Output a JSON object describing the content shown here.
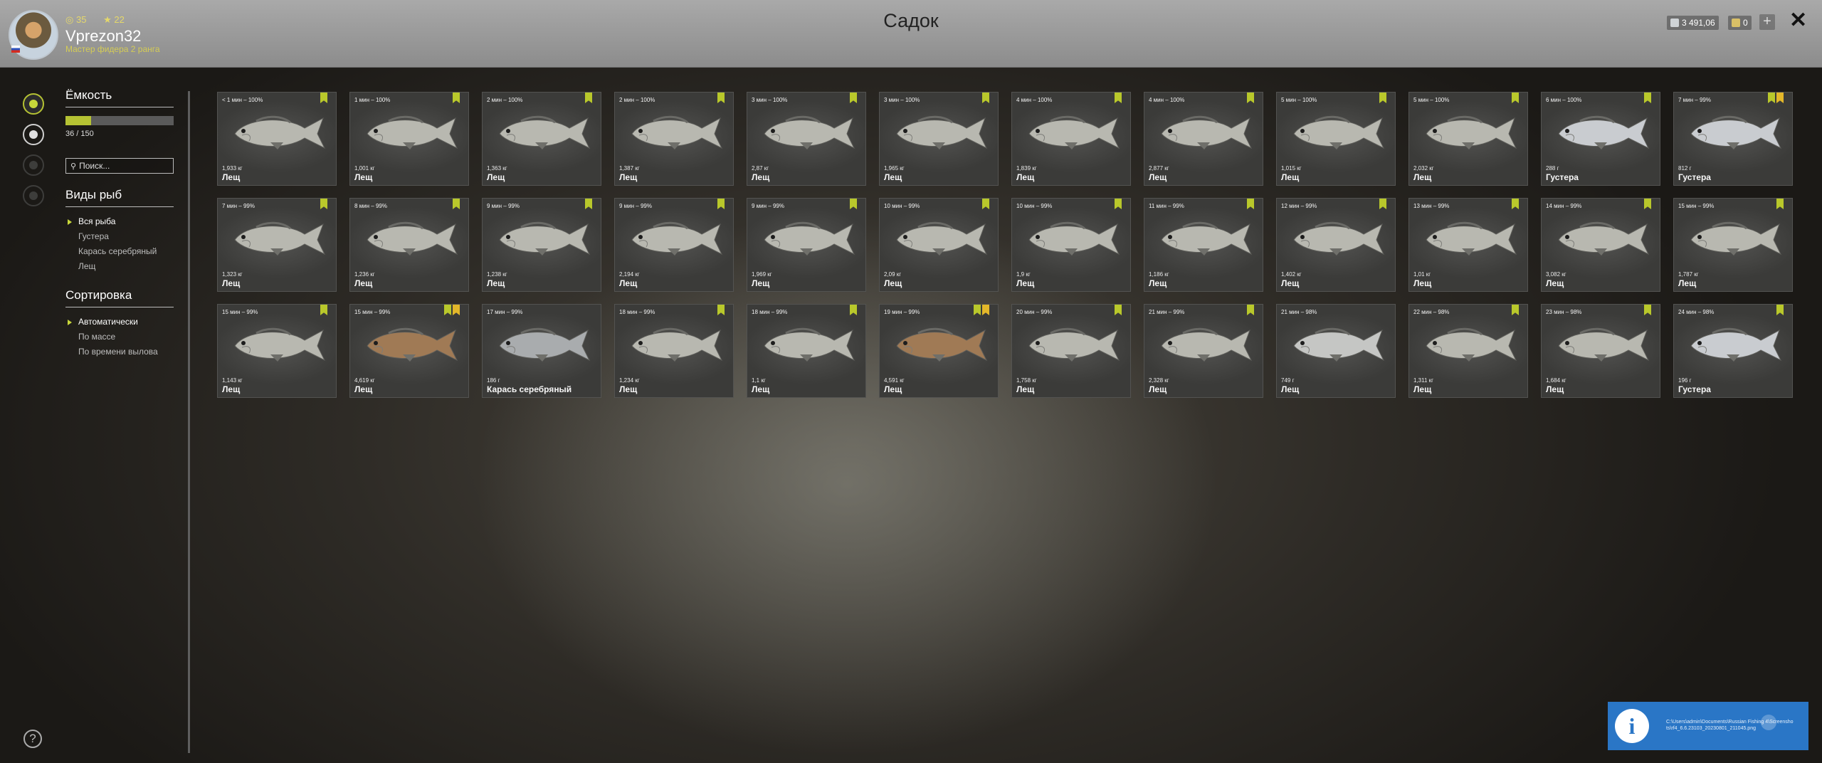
{
  "header": {
    "title": "Садок",
    "stat1": "35",
    "stat2": "22",
    "username": "Vprezon32",
    "rank": "Мастер фидера 2 ранга",
    "silver": "3 491,06",
    "gold": "0",
    "plus": "+",
    "close": "✕"
  },
  "sidebar": {
    "capacity_title": "Ёмкость",
    "capacity_fill": 0.24,
    "capacity_text": "36 / 150",
    "search_placeholder": "Поиск...",
    "species_title": "Виды рыб",
    "species": [
      "Вся рыба",
      "Густера",
      "Карась серебряный",
      "Лещ"
    ],
    "sort_title": "Сортировка",
    "sort": [
      "Автоматически",
      "По массе",
      "По времени вылова"
    ]
  },
  "help": "?",
  "fish": [
    {
      "time": "< 1 мин – 100%",
      "weight": "1,933 кг",
      "name": "Лещ",
      "badges": [
        "green"
      ],
      "color": "#b8b8b0"
    },
    {
      "time": "1 мин – 100%",
      "weight": "1,001 кг",
      "name": "Лещ",
      "badges": [
        "green"
      ],
      "color": "#b8b8b0"
    },
    {
      "time": "2 мин – 100%",
      "weight": "1,363 кг",
      "name": "Лещ",
      "badges": [
        "green"
      ],
      "color": "#b8b8b0"
    },
    {
      "time": "2 мин – 100%",
      "weight": "1,387 кг",
      "name": "Лещ",
      "badges": [
        "green"
      ],
      "color": "#b8b8b0"
    },
    {
      "time": "3 мин – 100%",
      "weight": "2,87 кг",
      "name": "Лещ",
      "badges": [
        "green"
      ],
      "color": "#b8b8b0"
    },
    {
      "time": "3 мин – 100%",
      "weight": "1,965 кг",
      "name": "Лещ",
      "badges": [
        "green"
      ],
      "color": "#b8b8b0"
    },
    {
      "time": "4 мин – 100%",
      "weight": "1,839 кг",
      "name": "Лещ",
      "badges": [
        "green"
      ],
      "color": "#b8b8b0"
    },
    {
      "time": "4 мин – 100%",
      "weight": "2,877 кг",
      "name": "Лещ",
      "badges": [
        "green"
      ],
      "color": "#b8b8b0"
    },
    {
      "time": "5 мин – 100%",
      "weight": "1,015 кг",
      "name": "Лещ",
      "badges": [
        "green"
      ],
      "color": "#b8b8b0"
    },
    {
      "time": "5 мин – 100%",
      "weight": "2,032 кг",
      "name": "Лещ",
      "badges": [
        "green"
      ],
      "color": "#b8b8b0"
    },
    {
      "time": "6 мин – 100%",
      "weight": "288 г",
      "name": "Густера",
      "badges": [
        "green"
      ],
      "color": "#c9ccd0"
    },
    {
      "time": "7 мин – 99%",
      "weight": "812 г",
      "name": "Густера",
      "badges": [
        "green",
        "gold"
      ],
      "color": "#c9ccd0"
    },
    {
      "time": "7 мин – 99%",
      "weight": "1,323 кг",
      "name": "Лещ",
      "badges": [
        "green"
      ],
      "color": "#b8b8b0"
    },
    {
      "time": "8 мин – 99%",
      "weight": "1,236 кг",
      "name": "Лещ",
      "badges": [
        "green"
      ],
      "color": "#b8b8b0"
    },
    {
      "time": "9 мин – 99%",
      "weight": "1,238 кг",
      "name": "Лещ",
      "badges": [
        "green"
      ],
      "color": "#b8b8b0"
    },
    {
      "time": "9 мин – 99%",
      "weight": "2,194 кг",
      "name": "Лещ",
      "badges": [
        "green"
      ],
      "color": "#b8b8b0"
    },
    {
      "time": "9 мин – 99%",
      "weight": "1,969 кг",
      "name": "Лещ",
      "badges": [
        "green"
      ],
      "color": "#b8b8b0"
    },
    {
      "time": "10 мин – 99%",
      "weight": "2,09 кг",
      "name": "Лещ",
      "badges": [
        "green"
      ],
      "color": "#b8b8b0"
    },
    {
      "time": "10 мин – 99%",
      "weight": "1,9 кг",
      "name": "Лещ",
      "badges": [
        "green"
      ],
      "color": "#b8b8b0"
    },
    {
      "time": "11 мин – 99%",
      "weight": "1,186 кг",
      "name": "Лещ",
      "badges": [
        "green"
      ],
      "color": "#b8b8b0"
    },
    {
      "time": "12 мин – 99%",
      "weight": "1,402 кг",
      "name": "Лещ",
      "badges": [
        "green"
      ],
      "color": "#b8b8b0"
    },
    {
      "time": "13 мин – 99%",
      "weight": "1,01 кг",
      "name": "Лещ",
      "badges": [
        "green"
      ],
      "color": "#b8b8b0"
    },
    {
      "time": "14 мин – 99%",
      "weight": "3,082 кг",
      "name": "Лещ",
      "badges": [
        "green"
      ],
      "color": "#b8b8b0"
    },
    {
      "time": "15 мин – 99%",
      "weight": "1,787 кг",
      "name": "Лещ",
      "badges": [
        "green"
      ],
      "color": "#b8b8b0"
    },
    {
      "time": "15 мин – 99%",
      "weight": "1,143 кг",
      "name": "Лещ",
      "badges": [
        "green"
      ],
      "color": "#b8b8b0"
    },
    {
      "time": "15 мин – 99%",
      "weight": "4,619 кг",
      "name": "Лещ",
      "badges": [
        "green",
        "gold"
      ],
      "color": "#a07a55"
    },
    {
      "time": "17 мин – 99%",
      "weight": "186 г",
      "name": "Карась серебряный",
      "badges": [],
      "color": "#a9acae"
    },
    {
      "time": "18 мин – 99%",
      "weight": "1,234 кг",
      "name": "Лещ",
      "badges": [
        "green"
      ],
      "color": "#b8b8b0"
    },
    {
      "time": "18 мин – 99%",
      "weight": "1,1 кг",
      "name": "Лещ",
      "badges": [
        "green"
      ],
      "color": "#b8b8b0"
    },
    {
      "time": "19 мин – 99%",
      "weight": "4,591 кг",
      "name": "Лещ",
      "badges": [
        "green",
        "gold"
      ],
      "color": "#a07a55"
    },
    {
      "time": "20 мин – 99%",
      "weight": "1,758 кг",
      "name": "Лещ",
      "badges": [
        "green"
      ],
      "color": "#b8b8b0"
    },
    {
      "time": "21 мин – 99%",
      "weight": "2,328 кг",
      "name": "Лещ",
      "badges": [
        "green"
      ],
      "color": "#b8b8b0"
    },
    {
      "time": "21 мин – 98%",
      "weight": "749 г",
      "name": "Лещ",
      "badges": [],
      "color": "#c5c6c4"
    },
    {
      "time": "22 мин – 98%",
      "weight": "1,311 кг",
      "name": "Лещ",
      "badges": [
        "green"
      ],
      "color": "#b8b8b0"
    },
    {
      "time": "23 мин – 98%",
      "weight": "1,684 кг",
      "name": "Лещ",
      "badges": [
        "green"
      ],
      "color": "#b8b8b0"
    },
    {
      "time": "24 мин – 98%",
      "weight": "196 г",
      "name": "Густера",
      "badges": [
        "green"
      ],
      "color": "#c9ccd0"
    }
  ],
  "notification": {
    "text": "C:\\Users\\admin\\Documents\\Russian Fishing 4\\Screenshots\\rf4_6.6.23103_20230801_211045.png"
  }
}
